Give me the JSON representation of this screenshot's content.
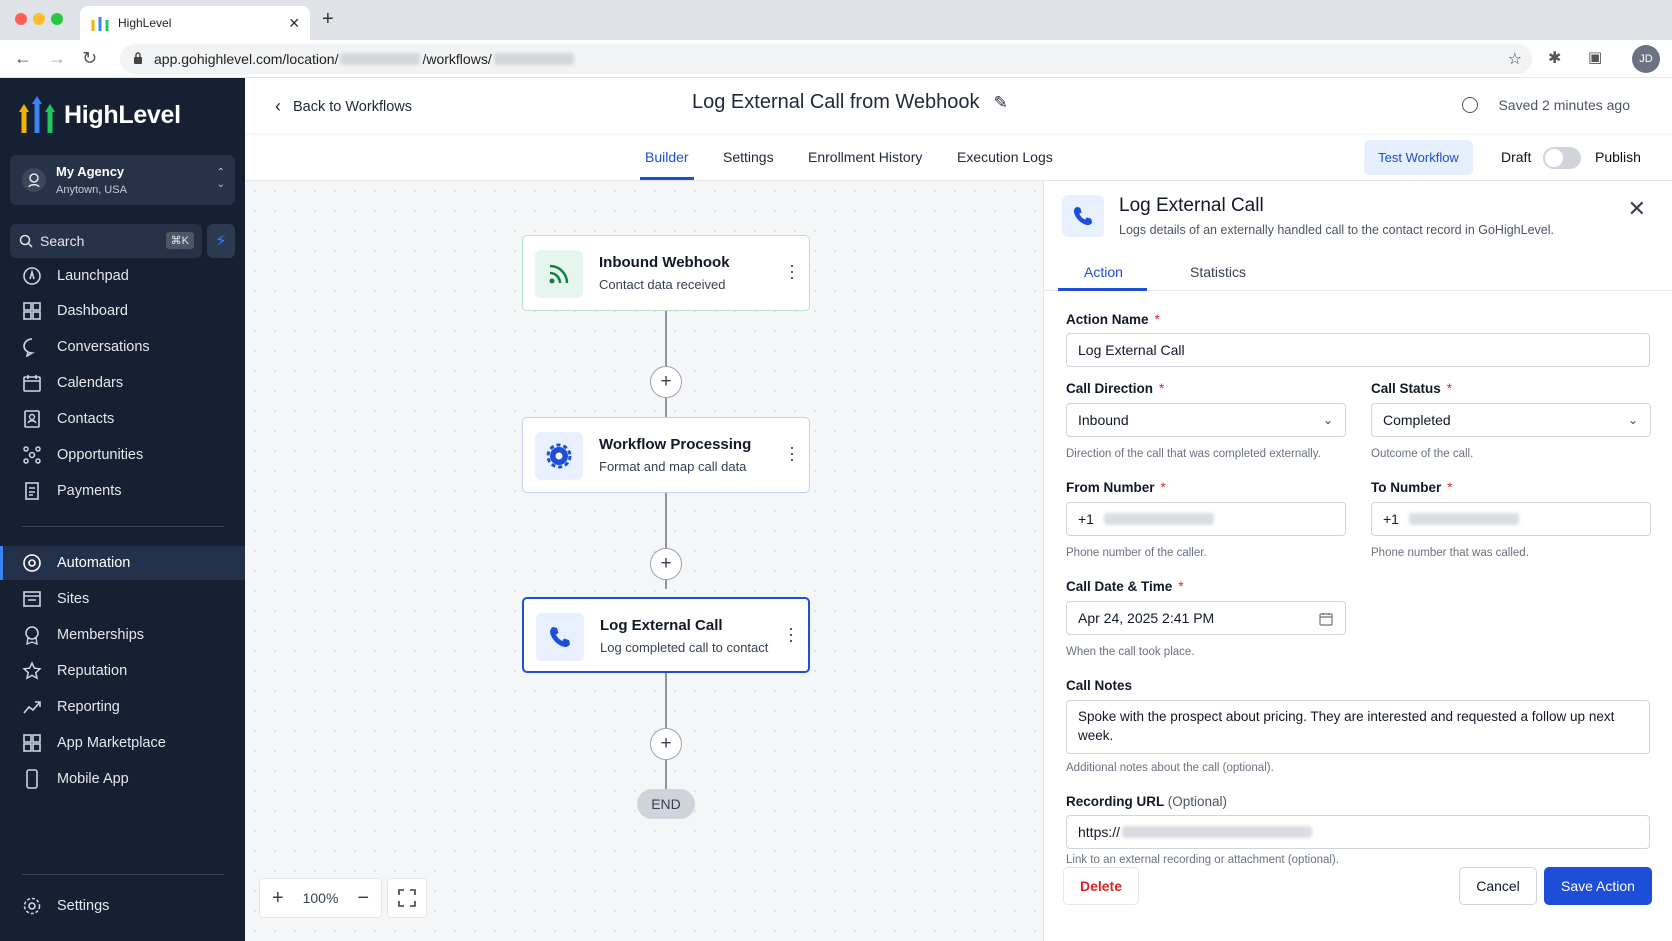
{
  "browser": {
    "tab_title": "HighLevel",
    "url_prefix": "app.gohighlevel.com/location/",
    "url_mid": "/workflows/",
    "avatar_initials": "JD"
  },
  "sidebar": {
    "brand": "HighLevel",
    "agency_name": "My Agency",
    "agency_location": "Anytown, USA",
    "search_label": "Search",
    "search_shortcut": "⌘K",
    "items_top": [
      {
        "label": "Launchpad",
        "icon": "launchpad-icon"
      },
      {
        "label": "Dashboard",
        "icon": "dashboard-icon"
      },
      {
        "label": "Conversations",
        "icon": "chat-icon"
      },
      {
        "label": "Calendars",
        "icon": "calendar-icon"
      },
      {
        "label": "Contacts",
        "icon": "contacts-icon"
      },
      {
        "label": "Opportunities",
        "icon": "opportunities-icon"
      },
      {
        "label": "Payments",
        "icon": "payments-icon"
      }
    ],
    "items_mid": [
      {
        "label": "Automation",
        "icon": "automation-icon",
        "active": true
      },
      {
        "label": "Sites",
        "icon": "sites-icon"
      },
      {
        "label": "Memberships",
        "icon": "memberships-icon"
      },
      {
        "label": "Reputation",
        "icon": "star-icon"
      },
      {
        "label": "Reporting",
        "icon": "reporting-icon"
      },
      {
        "label": "App Marketplace",
        "icon": "marketplace-icon"
      },
      {
        "label": "Mobile App",
        "icon": "mobile-icon"
      }
    ],
    "settings_label": "Settings"
  },
  "header": {
    "back_label": "Back to Workflows",
    "title": "Log External Call from Webhook",
    "saved_status": "Saved 2 minutes ago"
  },
  "subnav": {
    "tabs": [
      "Builder",
      "Settings",
      "Enrollment History",
      "Execution Logs"
    ],
    "active_tab": "Builder",
    "test_button": "Test Workflow",
    "draft_label": "Draft",
    "publish_label": "Publish",
    "published": false
  },
  "canvas": {
    "nodes": [
      {
        "title": "Inbound Webhook",
        "subtitle": "Contact data received",
        "icon": "webhook-icon"
      },
      {
        "title": "Workflow Processing",
        "subtitle": "Format and map call data",
        "icon": "gear-icon"
      },
      {
        "title": "Log External Call",
        "subtitle": "Log completed call to contact",
        "icon": "phone-icon",
        "selected": true
      }
    ],
    "end_label": "END",
    "zoom": "100%"
  },
  "panel": {
    "title": "Log External Call",
    "subtitle": "Logs details of an externally handled call to the contact record in GoHighLevel.",
    "tabs": [
      "Action",
      "Statistics"
    ],
    "active_tab": "Action",
    "action_name_label": "Action Name",
    "action_name_value": "Log External Call",
    "call_direction_label": "Call Direction",
    "call_direction_value": "Inbound",
    "call_direction_help": "Direction of the call that was completed externally.",
    "call_status_label": "Call Status",
    "call_status_value": "Completed",
    "call_status_help": "Outcome of the call.",
    "from_number_label": "From Number",
    "from_number_prefix": "+1",
    "from_number_help": "Phone number of the caller.",
    "to_number_label": "To Number",
    "to_number_prefix": "+1",
    "to_number_help": "Phone number that was called.",
    "datetime_label": "Call Date & Time",
    "datetime_value": "Apr 24, 2025 2:41 PM",
    "datetime_help": "When the call took place.",
    "notes_label": "Call Notes",
    "notes_value": "Spoke with the prospect about pricing. They are interested and requested a follow up next week.",
    "notes_help": "Additional notes about the call (optional).",
    "recording_label": "Recording URL",
    "recording_optional": "(Optional)",
    "recording_prefix": "https://",
    "recording_help": "Link to an external recording or attachment (optional).",
    "delete_button": "Delete",
    "cancel_button": "Cancel",
    "save_button": "Save Action",
    "required_mark": "*"
  },
  "colors": {
    "sidebar_bg": "#152033",
    "accent": "#1d4ed8",
    "danger": "#dc2626",
    "webhook_green": "#15803d"
  }
}
